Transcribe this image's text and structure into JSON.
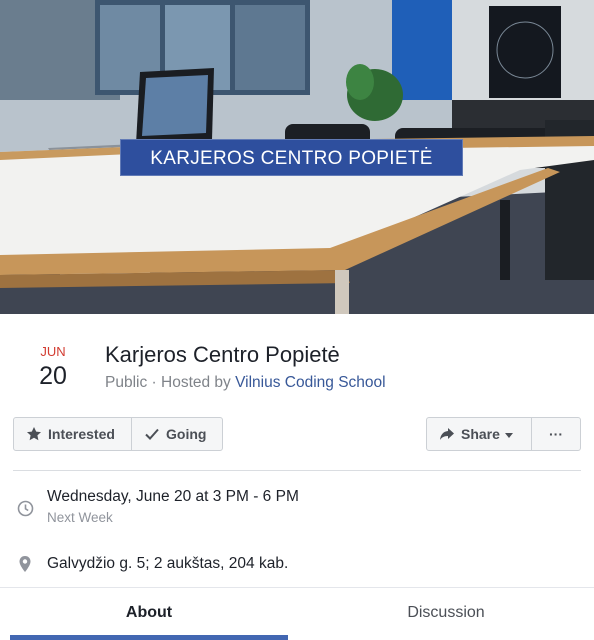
{
  "cover": {
    "banner_text": "KARJEROS CENTRO POPIETĖ"
  },
  "event": {
    "month": "JUN",
    "day": "20",
    "title": "Karjeros Centro Popietė",
    "privacy": "Public",
    "separator": " · ",
    "hosted_by_prefix": "Hosted by ",
    "host": "Vilnius Coding School"
  },
  "actions": {
    "interested_label": "Interested",
    "going_label": "Going",
    "share_label": "Share",
    "more_label": "···"
  },
  "details": {
    "time_main": "Wednesday, June 20 at 3 PM - 6 PM",
    "time_sub": "Next Week",
    "location": "Galvydžio g. 5; 2 aukštas, 204 kab."
  },
  "tabs": [
    {
      "label": "About",
      "active": true
    },
    {
      "label": "Discussion",
      "active": false
    }
  ],
  "icons": {
    "interested": "star-icon",
    "going": "check-icon",
    "share": "share-arrow-icon",
    "time": "clock-icon",
    "location": "map-pin-icon"
  },
  "colors": {
    "accent": "#4267b2",
    "month": "#d23b30",
    "host_link": "#385898",
    "banner": "#2e4f9e"
  }
}
